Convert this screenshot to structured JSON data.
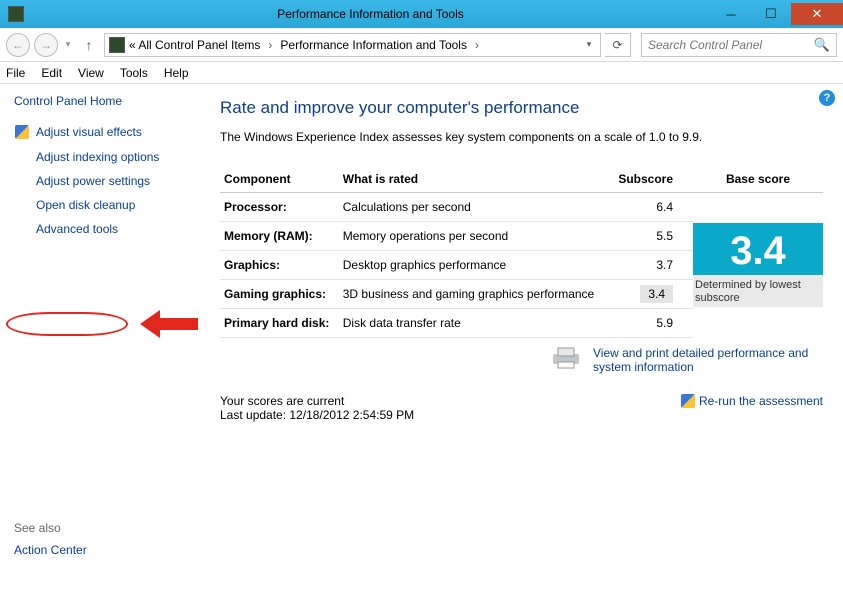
{
  "window": {
    "title": "Performance Information and Tools"
  },
  "nav": {
    "crumb1": "«  All Control Panel Items",
    "crumb2": "Performance Information and Tools"
  },
  "search": {
    "placeholder": "Search Control Panel"
  },
  "menu": {
    "file": "File",
    "edit": "Edit",
    "view": "View",
    "tools": "Tools",
    "help": "Help"
  },
  "sidebar": {
    "home": "Control Panel Home",
    "items": [
      {
        "label": "Adjust visual effects",
        "icon": true
      },
      {
        "label": "Adjust indexing options",
        "icon": false
      },
      {
        "label": "Adjust power settings",
        "icon": false
      },
      {
        "label": "Open disk cleanup",
        "icon": false
      },
      {
        "label": "Advanced tools",
        "icon": false
      }
    ],
    "see_also": "See also",
    "action_center": "Action Center"
  },
  "main": {
    "heading": "Rate and improve your computer's performance",
    "sub": "The Windows Experience Index assesses key system components on a scale of 1.0 to 9.9.",
    "cols": {
      "component": "Component",
      "rated": "What is rated",
      "sub": "Subscore",
      "base": "Base score"
    },
    "rows": [
      {
        "c": "Processor:",
        "r": "Calculations per second",
        "s": "6.4"
      },
      {
        "c": "Memory (RAM):",
        "r": "Memory operations per second",
        "s": "5.5"
      },
      {
        "c": "Graphics:",
        "r": "Desktop graphics performance",
        "s": "3.7"
      },
      {
        "c": "Gaming graphics:",
        "r": "3D business and gaming graphics performance",
        "s": "3.4"
      },
      {
        "c": "Primary hard disk:",
        "r": "Disk data transfer rate",
        "s": "5.9"
      }
    ],
    "base_score": "3.4",
    "base_note": "Determined by lowest subscore",
    "detail_link": "View and print detailed performance and system information",
    "status1": "Your scores are current",
    "status2": "Last update: 12/18/2012 2:54:59 PM",
    "rerun": "Re-run the assessment"
  }
}
